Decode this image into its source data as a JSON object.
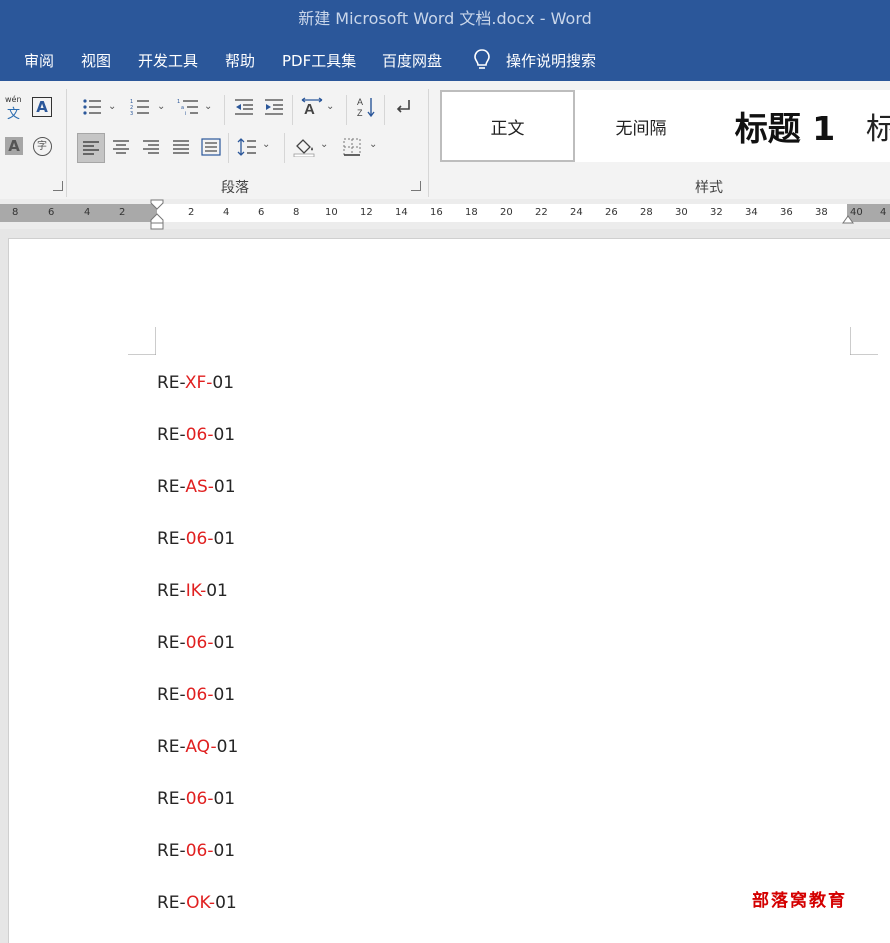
{
  "window": {
    "title": "新建 Microsoft Word 文档.docx  -  Word"
  },
  "menu": {
    "items": [
      "审阅",
      "视图",
      "开发工具",
      "帮助",
      "PDF工具集",
      "百度网盘"
    ],
    "tell_me": "操作说明搜索"
  },
  "ribbon": {
    "font_group": {
      "phonetic_label": "wén",
      "phonetic_char": "文",
      "border_char": "A",
      "shade_char": "A",
      "enclose_char": "字"
    },
    "paragraph_group": {
      "label": "段落"
    },
    "styles_group": {
      "label": "样式",
      "items": [
        "正文",
        "无间隔",
        "标题 1",
        "标"
      ]
    }
  },
  "ruler": {
    "left_labels": [
      "8",
      "6",
      "4",
      "2"
    ],
    "right_labels": [
      "2",
      "4",
      "6",
      "8",
      "10",
      "12",
      "14",
      "16",
      "18",
      "20",
      "22",
      "24",
      "26",
      "28",
      "30",
      "32",
      "34",
      "36",
      "38",
      "40",
      "4"
    ]
  },
  "document": {
    "lines": [
      {
        "prefix": "RE-",
        "middle": "XF-",
        "suffix": "01"
      },
      {
        "prefix": "RE-",
        "middle": "06-",
        "suffix": "01"
      },
      {
        "prefix": "RE-",
        "middle": "AS-",
        "suffix": "01"
      },
      {
        "prefix": "RE-",
        "middle": "06-",
        "suffix": "01"
      },
      {
        "prefix": "RE-",
        "middle": "IK-",
        "suffix": "01"
      },
      {
        "prefix": "RE-",
        "middle": "06-",
        "suffix": "01"
      },
      {
        "prefix": "RE-",
        "middle": "06-",
        "suffix": "01"
      },
      {
        "prefix": "RE-",
        "middle": "AQ-",
        "suffix": "01"
      },
      {
        "prefix": "RE-",
        "middle": "06-",
        "suffix": "01"
      },
      {
        "prefix": "RE-",
        "middle": "06-",
        "suffix": "01"
      },
      {
        "prefix": "RE-",
        "middle": "OK-",
        "suffix": "01"
      }
    ],
    "highlight_color": "#e02020"
  },
  "watermark": "部落窝教育",
  "colors": {
    "titlebar": "#2b579a",
    "watermark": "#d40000"
  }
}
